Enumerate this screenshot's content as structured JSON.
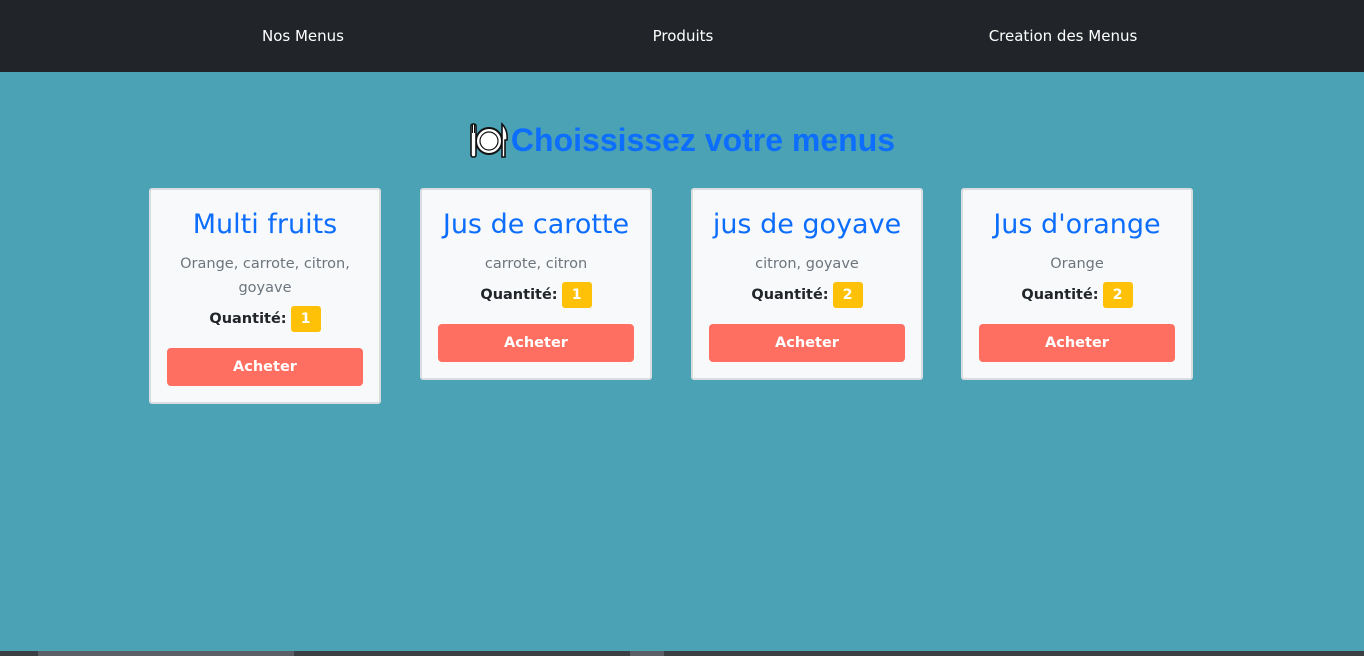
{
  "nav": {
    "items": [
      {
        "label": "Nos Menus"
      },
      {
        "label": "Produits"
      },
      {
        "label": "Creation des Menus"
      }
    ]
  },
  "heading": {
    "icon": "fork-knife-plate-icon",
    "text": "Choississez votre menus"
  },
  "menus": [
    {
      "title": "Multi fruits",
      "description": "Orange, carrote, citron, goyave",
      "quantity_label": "Quantité:",
      "quantity": "1",
      "buy_label": "Acheter"
    },
    {
      "title": "Jus de carotte",
      "description": "carrote, citron",
      "quantity_label": "Quantité:",
      "quantity": "1",
      "buy_label": "Acheter"
    },
    {
      "title": "jus de goyave",
      "description": "citron, goyave",
      "quantity_label": "Quantité:",
      "quantity": "2",
      "buy_label": "Acheter"
    },
    {
      "title": "Jus d'orange",
      "description": "Orange",
      "quantity_label": "Quantité:",
      "quantity": "2",
      "buy_label": "Acheter"
    }
  ],
  "colors": {
    "navbar": "#212529",
    "background": "#4aa2b4",
    "accent": "#0d6efd",
    "badge": "#ffc107",
    "button": "#ff6f61"
  }
}
